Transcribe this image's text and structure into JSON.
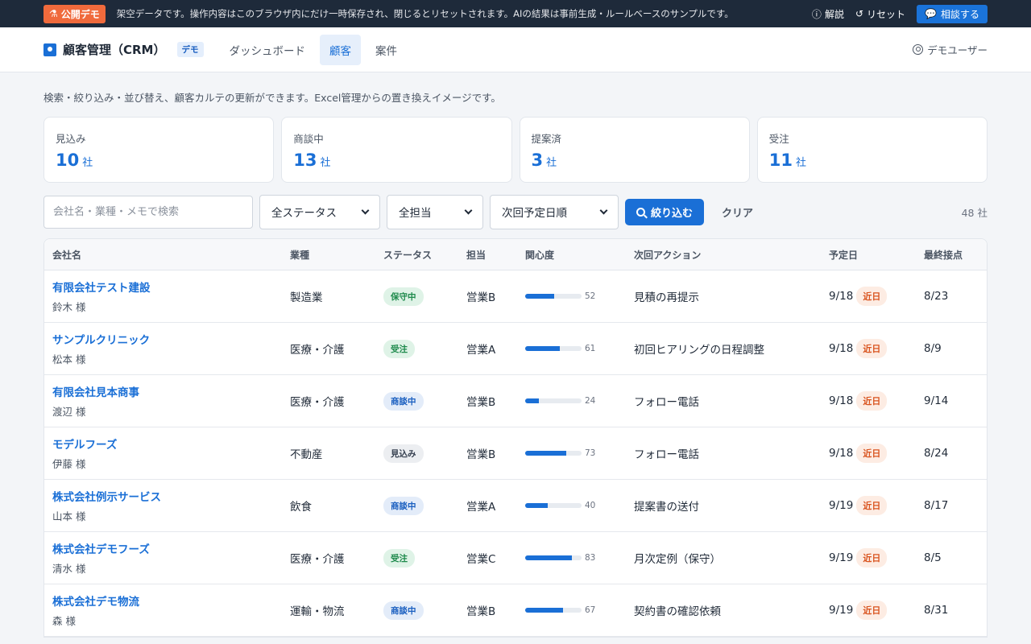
{
  "topbar": {
    "demo_label": "公開デモ",
    "message": "架空データです。操作内容はこのブラウザ内にだけ一時保存され、閉じるとリセットされます。AIの結果は事前生成・ルールベースのサンプルです。",
    "explain_label": "解説",
    "reset_label": "リセット",
    "consult_label": "相談する"
  },
  "header": {
    "title": "顧客管理（CRM）",
    "demo_badge": "デモ",
    "nav": [
      "ダッシュボード",
      "顧客",
      "案件"
    ],
    "user": "デモユーザー"
  },
  "description": "検索・絞り込み・並び替え、顧客カルテの更新ができます。Excel管理からの置き換えイメージです。",
  "stats": [
    {
      "label": "見込み",
      "value": "10",
      "unit": "社"
    },
    {
      "label": "商談中",
      "value": "13",
      "unit": "社"
    },
    {
      "label": "提案済",
      "value": "3",
      "unit": "社"
    },
    {
      "label": "受注",
      "value": "11",
      "unit": "社"
    }
  ],
  "filters": {
    "search_placeholder": "会社名・業種・メモで検索",
    "status_selected": "全ステータス",
    "owner_selected": "全担当",
    "sort_selected": "次回予定日順",
    "filter_button": "絞り込む",
    "clear_button": "クリア",
    "count": "48 社"
  },
  "table": {
    "headers": [
      "会社名",
      "業種",
      "ステータス",
      "担当",
      "関心度",
      "次回アクション",
      "予定日",
      "最終接点"
    ],
    "rows": [
      {
        "company": "有限会社テスト建設",
        "contact": "鈴木 様",
        "industry": "製造業",
        "status": "保守中",
        "status_color": "green",
        "owner": "営業B",
        "interest": 52,
        "next_action": "見積の再提示",
        "due": "9/18",
        "due_tag": "近日",
        "last_contact": "8/23"
      },
      {
        "company": "サンプルクリニック",
        "contact": "松本 様",
        "industry": "医療・介護",
        "status": "受注",
        "status_color": "green",
        "owner": "営業A",
        "interest": 61,
        "next_action": "初回ヒアリングの日程調整",
        "due": "9/18",
        "due_tag": "近日",
        "last_contact": "8/9"
      },
      {
        "company": "有限会社見本商事",
        "contact": "渡辺 様",
        "industry": "医療・介護",
        "status": "商談中",
        "status_color": "blue",
        "owner": "営業B",
        "interest": 24,
        "next_action": "フォロー電話",
        "due": "9/18",
        "due_tag": "近日",
        "last_contact": "9/14"
      },
      {
        "company": "モデルフーズ",
        "contact": "伊藤 様",
        "industry": "不動産",
        "status": "見込み",
        "status_color": "gray",
        "owner": "営業B",
        "interest": 73,
        "next_action": "フォロー電話",
        "due": "9/18",
        "due_tag": "近日",
        "last_contact": "8/24"
      },
      {
        "company": "株式会社例示サービス",
        "contact": "山本 様",
        "industry": "飲食",
        "status": "商談中",
        "status_color": "blue",
        "owner": "営業A",
        "interest": 40,
        "next_action": "提案書の送付",
        "due": "9/19",
        "due_tag": "近日",
        "last_contact": "8/17"
      },
      {
        "company": "株式会社デモフーズ",
        "contact": "清水 様",
        "industry": "医療・介護",
        "status": "受注",
        "status_color": "green",
        "owner": "営業C",
        "interest": 83,
        "next_action": "月次定例（保守）",
        "due": "9/19",
        "due_tag": "近日",
        "last_contact": "8/5"
      },
      {
        "company": "株式会社デモ物流",
        "contact": "森 様",
        "industry": "運輸・物流",
        "status": "商談中",
        "status_color": "blue",
        "owner": "営業B",
        "interest": 67,
        "next_action": "契約書の確認依頼",
        "due": "9/19",
        "due_tag": "近日",
        "last_contact": "8/31"
      }
    ]
  }
}
